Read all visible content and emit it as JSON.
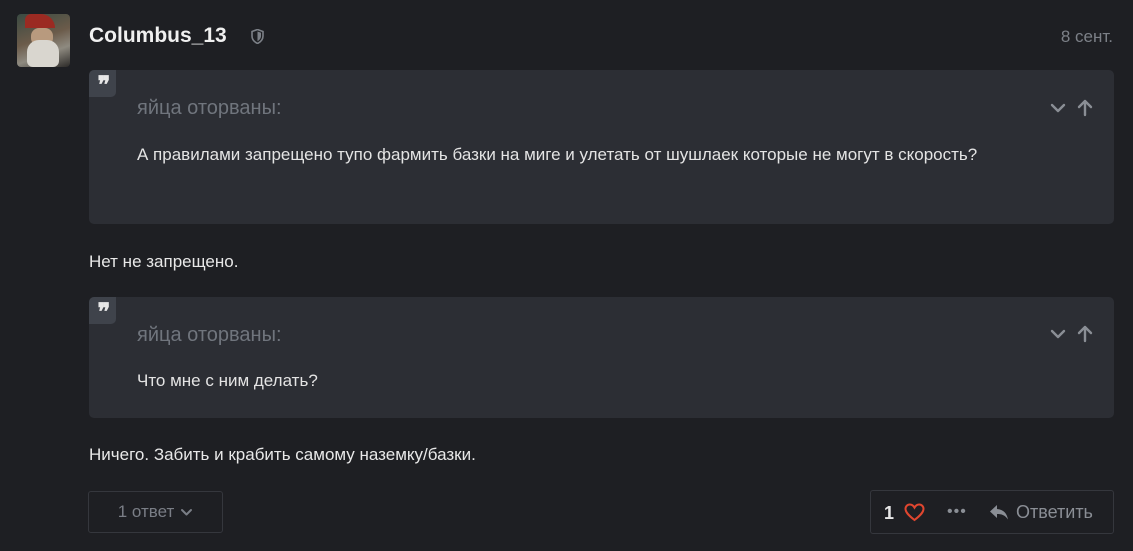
{
  "post": {
    "author": "Columbus_13",
    "date": "8 сент.",
    "quotes": [
      {
        "author": "яйца оторваны:",
        "text": "А правилами запрещено тупо фармить базки на миге и улетать от шушлаек которые не могут в скорость?"
      },
      {
        "author": "яйца оторваны:",
        "text": "Что мне с ним делать?"
      }
    ],
    "paragraphs": [
      "Нет не запрещено.",
      "Ничего. Забить и крабить самому наземку/базки."
    ]
  },
  "footer": {
    "replies_label": "1 ответ",
    "like_count": "1",
    "more_label": "•••",
    "reply_label": "Ответить"
  },
  "icons": {
    "quote": "quote-icon",
    "shield": "shield-icon",
    "heart": "heart-icon",
    "reply": "reply-icon"
  },
  "colors": {
    "background": "#1e1f23",
    "quote_bg": "#2c2e34",
    "heart": "#e0462f"
  }
}
